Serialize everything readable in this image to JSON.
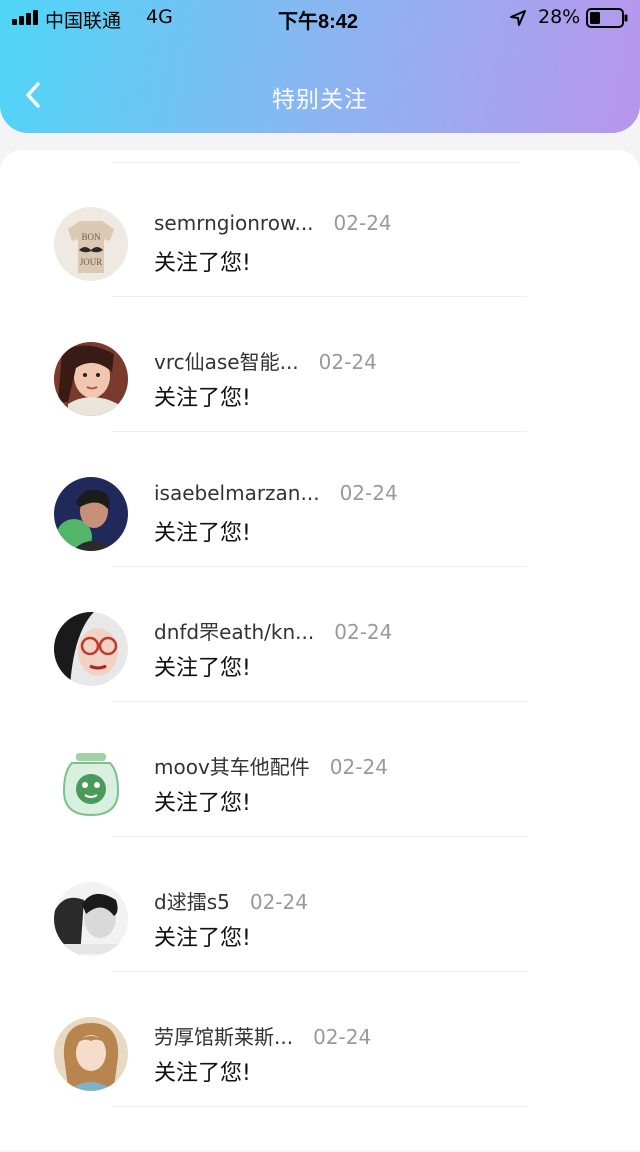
{
  "status_bar": {
    "carrier": "中国联通",
    "network": "4G",
    "time": "下午8:42",
    "battery": "28%"
  },
  "header": {
    "title": "特别关注"
  },
  "notifications": [
    {
      "username": "semrngionrow...",
      "date": "02-24",
      "message": "关注了您!"
    },
    {
      "username": "vrc仙ase智能...",
      "date": "02-24",
      "message": "关注了您!"
    },
    {
      "username": "isaebelmarzan...",
      "date": "02-24",
      "message": "关注了您!"
    },
    {
      "username": "dnfd罘eath/kn...",
      "date": "02-24",
      "message": "关注了您!"
    },
    {
      "username": "moov其车他配件",
      "date": "02-24",
      "message": "关注了您!"
    },
    {
      "username": "d逑擂s5",
      "date": "02-24",
      "message": "关注了您!"
    },
    {
      "username": "劳厚馆斯莱斯...",
      "date": "02-24",
      "message": "关注了您!"
    }
  ],
  "avatar_badges": {
    "shirt_text_1": "BON",
    "shirt_text_2": "JOUR"
  }
}
